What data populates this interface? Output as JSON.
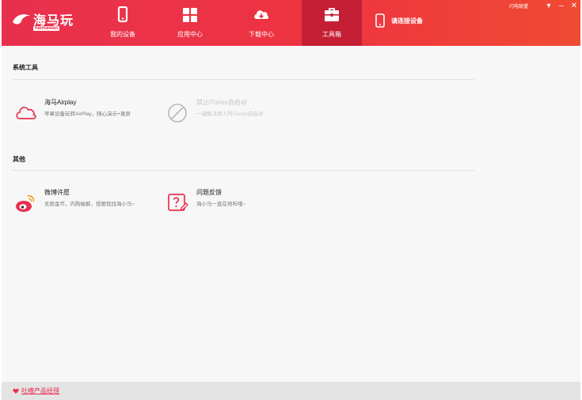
{
  "app": {
    "logo_text": "海马玩",
    "logo_sub": "haimawan",
    "accent": "#e8304e"
  },
  "header": {
    "tabs": [
      {
        "label": "我的设备",
        "icon": "phone-icon"
      },
      {
        "label": "应用中心",
        "icon": "grid-icon"
      },
      {
        "label": "下载中心",
        "icon": "cloud-download-icon"
      },
      {
        "label": "工具箱",
        "icon": "toolbox-icon",
        "active": true
      }
    ],
    "device_select_label": "请连接设备",
    "top_link": "闪电联盟",
    "win_buttons": {
      "menu": "▾",
      "minimize": "–",
      "close": "✕"
    }
  },
  "sections": {
    "system": {
      "title": "系统工具",
      "tools": [
        {
          "name": "海马Airplay",
          "desc": "苹果设备玩转AirPlay，随心演示+录屏",
          "icon": "cloud-icon",
          "enabled": true
        },
        {
          "name": "禁止iTunes自启动",
          "desc": "一键解决烦人的iTunes自启动",
          "icon": "forbidden-icon",
          "enabled": false
        }
      ]
    },
    "other": {
      "title": "其他",
      "tools": [
        {
          "name": "微博许愿",
          "desc": "无限金币，内购破解，想要就找海小马~",
          "icon": "weibo-icon",
          "enabled": true
        },
        {
          "name": "问题反馈",
          "desc": "海小马一直在倾听哦~",
          "icon": "feedback-icon",
          "enabled": true
        }
      ]
    }
  },
  "footer": {
    "link_label": "吐槽产品经理",
    "icon": "heart-icon"
  }
}
